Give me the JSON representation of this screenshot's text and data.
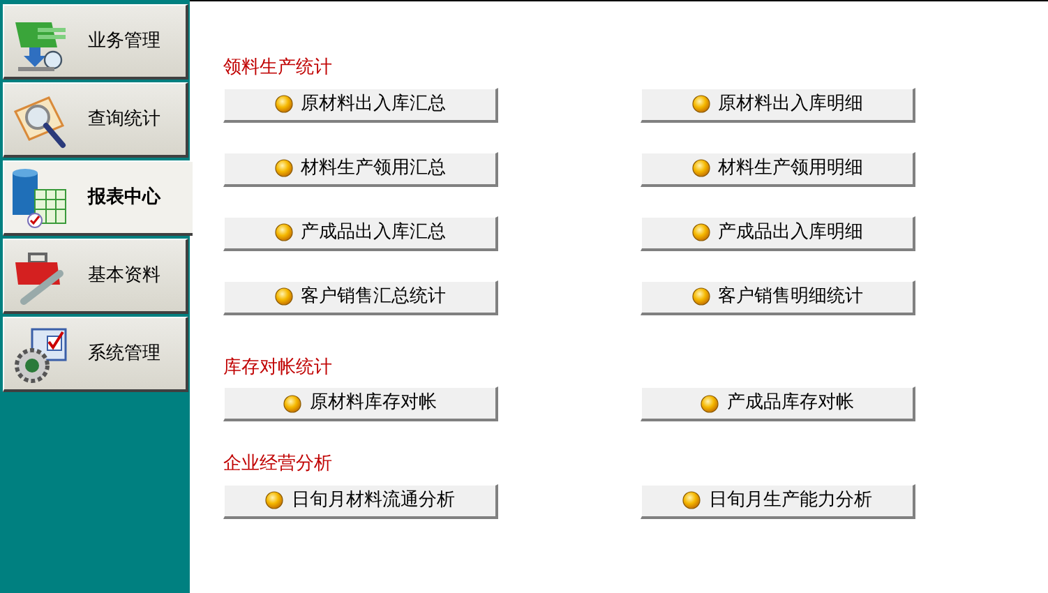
{
  "sidebar": {
    "items": [
      {
        "label": "业务管理",
        "selected": false
      },
      {
        "label": "查询统计",
        "selected": false
      },
      {
        "label": "报表中心",
        "selected": true
      },
      {
        "label": "基本资料",
        "selected": false
      },
      {
        "label": "系统管理",
        "selected": false
      }
    ]
  },
  "sections": [
    {
      "title": "领料生产统计",
      "buttons": [
        {
          "label": "原材料出入库汇总"
        },
        {
          "label": "原材料出入库明细"
        },
        {
          "label": "材料生产领用汇总"
        },
        {
          "label": "材料生产领用明细"
        },
        {
          "label": "产成品出入库汇总"
        },
        {
          "label": "产成品出入库明细"
        },
        {
          "label": "客户销售汇总统计"
        },
        {
          "label": "客户销售明细统计"
        }
      ]
    },
    {
      "title": "库存对帐统计",
      "buttons": [
        {
          "label": "原材料库存对帐"
        },
        {
          "label": "产成品库存对帐"
        }
      ]
    },
    {
      "title": "企业经营分析",
      "buttons": [
        {
          "label": "日旬月材料流通分析"
        },
        {
          "label": "日旬月生产能力分析"
        }
      ]
    }
  ]
}
